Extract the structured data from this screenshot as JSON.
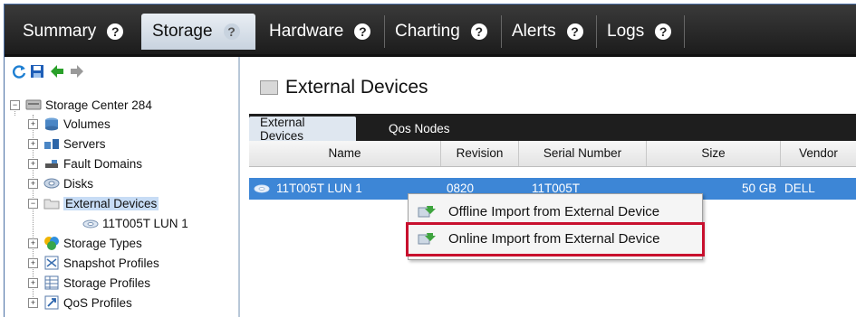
{
  "top_tabs": [
    {
      "label": "Summary"
    },
    {
      "label": "Storage"
    },
    {
      "label": "Hardware"
    },
    {
      "label": "Charting"
    },
    {
      "label": "Alerts"
    },
    {
      "label": "Logs"
    }
  ],
  "tree": {
    "root": "Storage Center 284",
    "items": [
      {
        "label": "Volumes"
      },
      {
        "label": "Servers"
      },
      {
        "label": "Fault Domains"
      },
      {
        "label": "Disks"
      },
      {
        "label": "External Devices"
      },
      {
        "label": "11T005T LUN 1"
      },
      {
        "label": "Storage Types"
      },
      {
        "label": "Snapshot Profiles"
      },
      {
        "label": "Storage Profiles"
      },
      {
        "label": "QoS Profiles"
      }
    ]
  },
  "main": {
    "title": "External Devices",
    "tabs": [
      {
        "label": "External Devices"
      },
      {
        "label": "Qos Nodes"
      }
    ],
    "columns": [
      "Name",
      "Revision",
      "Serial Number",
      "Size",
      "Vendor"
    ],
    "rows": [
      {
        "name": "11T005T LUN 1",
        "revision": "0820",
        "serial": "11T005T",
        "size": "50 GB",
        "vendor": "DELL"
      }
    ]
  },
  "context_menu": {
    "items": [
      {
        "label": "Offline Import from External Device"
      },
      {
        "label": "Online Import from External Device"
      }
    ]
  },
  "colors": {
    "accent": "#3d86d6",
    "highlight_box": "#c8102e",
    "topbar": "#1c1c1c"
  }
}
